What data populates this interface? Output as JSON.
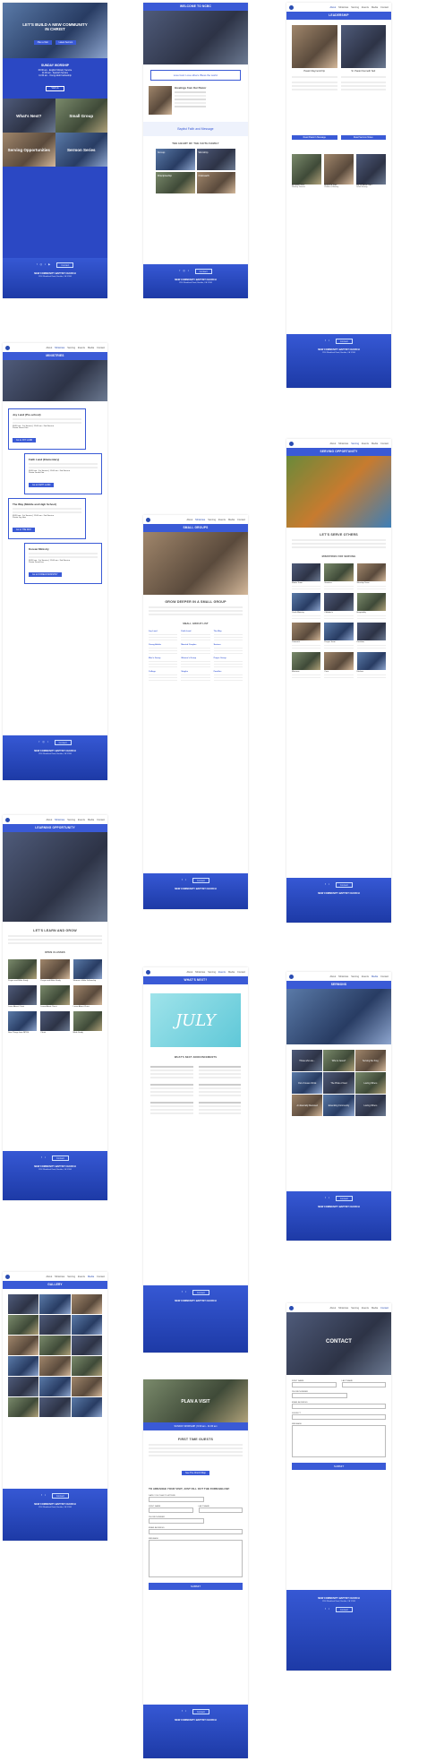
{
  "nav": {
    "items": [
      "About",
      "Ministries",
      "Serving",
      "Events",
      "Media",
      "Contact"
    ],
    "logo_text": "NEW COMMUNITY BAPTIST CHURCH"
  },
  "footer": {
    "contact_label": "Contact",
    "org": "NEW COMMUNITY BAPTIST CHURCH",
    "address": "1234 Woodland Road, Boulder, CA 12345"
  },
  "home": {
    "hero_title": "LET'S BUILD A NEW COMMUNITY IN CHRIST",
    "hero_btn1": "Plan a Visit",
    "hero_btn2": "Latest Sermon",
    "worship_title": "SUNDAY WORSHIP",
    "worship_lines": [
      "09:30 am - English Ministry Service",
      "11:00 am - Spanish Service",
      "11:30 am - Young Adult Fellowship"
    ],
    "more_btn": "Visit Us",
    "tiles": [
      "What's Next?",
      "Small Group",
      "Serving Opportunities",
      "Sermon Series"
    ]
  },
  "welcome": {
    "band": "WELCOME TO NCBC",
    "tagline": "Love God. Love others. Bless the world.",
    "greeting_title": "Greetings from Our Pastor",
    "family_title": "THE HEART OF THE FAITH FAMILY",
    "convention": "Baptist Faith and Message",
    "tiles": [
      "Group",
      "Worship",
      "Discipleship",
      "Outreach"
    ]
  },
  "leadership": {
    "band": "LEADERSHIP",
    "pastors": [
      "Pastor Raymond Fip",
      "Sr. Pastor Kenneth Seil"
    ],
    "pastor_btns": [
      "Read Pastor's Message",
      "Read Sermon Notes"
    ],
    "staff": [
      "Elizabeth Kim",
      "Rebecca Park",
      "Jay & Jamie Han"
    ],
    "staff_roles": [
      "Worship Director",
      "Children's Ministry",
      "Youth Ministry"
    ]
  },
  "ministries": {
    "band": "MINISTRIES",
    "items": [
      {
        "title": "Joy Land (Pre-school)",
        "time": "09:30 am - 1st Service  |  11:00 am - 2nd Service",
        "leader": "Pastor Grace Kim",
        "btn": "Go to JOY LAND"
      },
      {
        "title": "Faith Land (Elementary)",
        "time": "09:30 am - 1st Service  |  11:00 am - 2nd Service",
        "leader": "Pastor Jacob Kim",
        "btn": "Go to FAITH LAND"
      },
      {
        "title": "The Way (Middle and High School)",
        "time": "09:30 am - 1st Service  |  11:00 am - 2nd Service",
        "leader": "Pastor Jay Han",
        "btn": "Go to THE WAY"
      },
      {
        "title": "Korean Ministry",
        "time": "09:30 am - 1st Service  |  11:00 am - 2nd Service",
        "leader": "Pastor David Lee",
        "btn": "Go to KOREAN MINISTRY"
      }
    ]
  },
  "small_groups": {
    "band": "SMALL GROUPS",
    "heading": "GROW DEEPER IN A SMALL GROUP",
    "list_title": "SMALL GROUP LIST",
    "groups": [
      "Joy Land",
      "Faith Land",
      "The Way",
      "Young Adults",
      "Married Couples",
      "Seniors",
      "Men's Group",
      "Women's Group",
      "Prayer Group",
      "College",
      "Singles",
      "Families"
    ]
  },
  "serving": {
    "band": "SERVING OPPORTUNITY",
    "heading": "LET'S SERVE OTHERS",
    "list_title": "MINISTRIES FOR SERVING",
    "roles": [
      "Media Team",
      "Greeters",
      "Worship Team",
      "Youth Ministry",
      "Children's",
      "Hospitality",
      "Outreach",
      "Prayer Team",
      "Facilities",
      "Missions",
      "Care",
      "Kitchen"
    ]
  },
  "learning": {
    "band": "LEARNING OPPORTUNITY",
    "heading": "LET'S LEARN AND GROW",
    "list_title": "OPEN CLASSES",
    "classes": [
      "Prayer and Bible Study",
      "Prayer and Bible Study",
      "Women's Bible Fellowship",
      "Learn About Christ",
      "Learn About Christ",
      "Learn About Christ",
      "New Things from NPSS",
      "Christ",
      "Bible Study"
    ]
  },
  "whats_next": {
    "band": "WHAT'S NEXT?",
    "banner": "JULY",
    "subtitle": "WHAT'S NEXT ANNOUNCEMENTS"
  },
  "sermons": {
    "band": "SERMONS",
    "tiles": [
      "Those who are...",
      "Who is Jesus?",
      "Serving the King",
      "Out of Jesus Christ",
      "The Pride of God",
      "Loving Others",
      "An Eternally Restored",
      "Extending Community",
      "Loving Others"
    ]
  },
  "gallery": {
    "band": "GALLERY"
  },
  "plan_visit": {
    "hero_title": "PLAN A VISIT",
    "worship_bar": "SUNDAY WORSHIP  |  9:30 am - 11:00 am",
    "heading": "FIRST TIME GUESTS",
    "btn": "See The Church Map",
    "form_title": "TO ARRANGE YOUR VISIT, JUST FILL OUT THE FORM BELOW:",
    "date_label": "DATE YOU PLAN TO ATTEND",
    "first_label": "FIRST NAME",
    "last_label": "LAST NAME",
    "phone_label": "PHONE NUMBER",
    "email_label": "EMAIL ADDRESS",
    "message_label": "MESSAGE",
    "submit": "SUBMIT"
  },
  "contact": {
    "hero_title": "CONTACT",
    "first_label": "FIRST NAME",
    "last_label": "LAST NAME",
    "phone_label": "PHONE NUMBER",
    "email_label": "EMAIL ADDRESS",
    "subject_label": "SUBJECT",
    "message_label": "MESSAGE",
    "submit": "SUBMIT"
  }
}
